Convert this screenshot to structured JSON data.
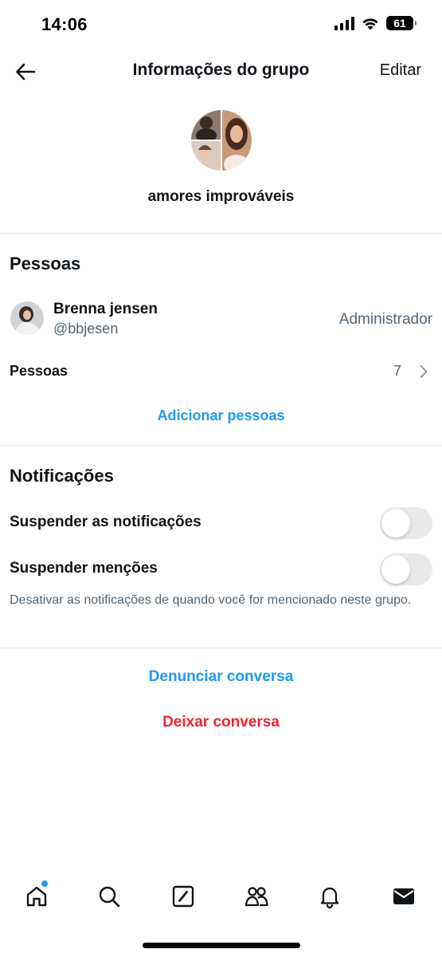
{
  "status_bar": {
    "time": "14:06",
    "battery": "61"
  },
  "header": {
    "title": "Informações do grupo",
    "edit_label": "Editar"
  },
  "group": {
    "name": "amores improváveis"
  },
  "people_section": {
    "title": "Pessoas",
    "member": {
      "name": "Brenna jensen",
      "handle": "@bbjesen",
      "role": "Administrador"
    },
    "people_row": {
      "label": "Pessoas",
      "count": "7"
    },
    "add_label": "Adicionar pessoas"
  },
  "notifications_section": {
    "title": "Notificações",
    "toggles": [
      {
        "label": "Suspender as notificações",
        "on": false
      },
      {
        "label": "Suspender menções",
        "on": false
      }
    ],
    "help": "Desativar as notificações de quando você for mencionado neste grupo."
  },
  "actions": {
    "report": "Denunciar conversa",
    "leave": "Deixar conversa"
  },
  "colors": {
    "accent": "#1d9bf0",
    "danger": "#f4212e",
    "secondary_text": "#536471",
    "divider": "#e6e9eb"
  },
  "tab_bar": {
    "items": [
      "home-icon",
      "search-icon",
      "compose-icon",
      "communities-icon",
      "bell-icon",
      "mail-icon"
    ],
    "active": "mail-icon"
  }
}
